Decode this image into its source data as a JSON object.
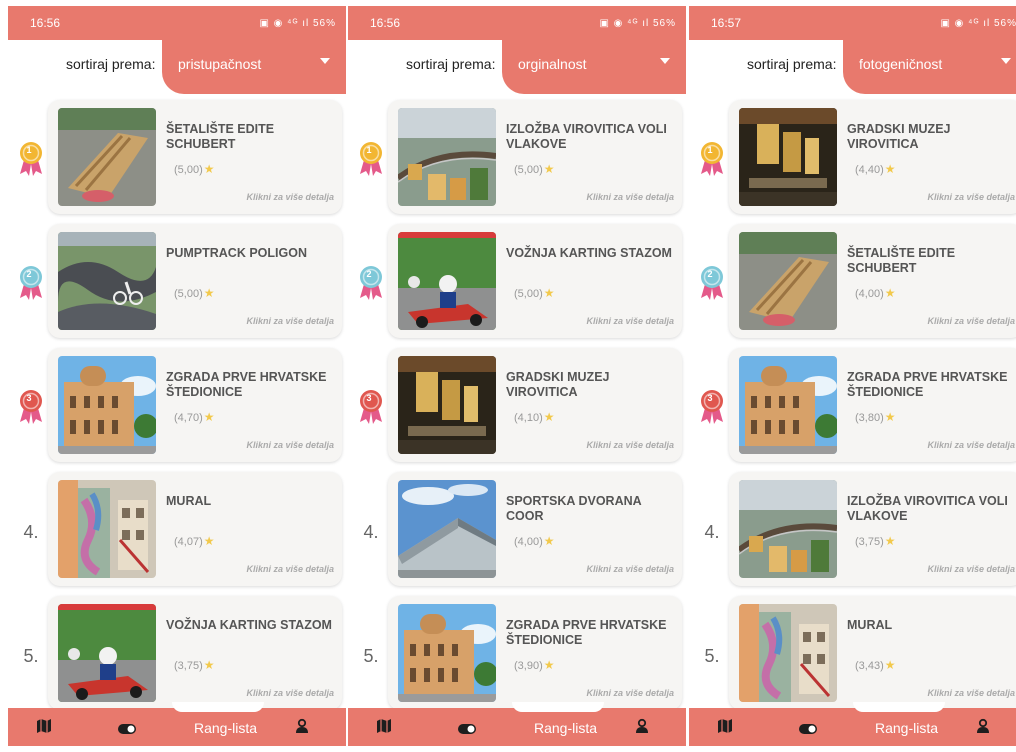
{
  "panels": [
    {
      "time": "16:56",
      "status_icons": "▣ ◉ ⁴ᴳ ıl 56%",
      "sort_label": "sortiraj prema:",
      "sort_value": "pristupačnost",
      "items": [
        {
          "rank": "1",
          "title": "ŠETALIŠTE EDITE SCHUBERT",
          "rating": "(5,00)",
          "detail": "Klikni za više detalja",
          "thumb": "promenade"
        },
        {
          "rank": "2",
          "title": "PUMPTRACK POLIGON",
          "rating": "(5,00)",
          "detail": "Klikni za više detalja",
          "thumb": "pumptrack"
        },
        {
          "rank": "3",
          "title": "ZGRADA PRVE HRVATSKE ŠTEDIONICE",
          "rating": "(4,70)",
          "detail": "Klikni za više detalja",
          "thumb": "building"
        },
        {
          "rank": "4.",
          "title": "MURAL",
          "rating": "(4,07)",
          "detail": "Klikni za više detalja",
          "thumb": "mural"
        },
        {
          "rank": "5.",
          "title": "VOŽNJA KARTING STAZOM",
          "rating": "(3,75)",
          "detail": "Klikni za više detalja",
          "thumb": "karting"
        }
      ]
    },
    {
      "time": "16:56",
      "status_icons": "▣ ◉ ⁴ᴳ ıl 56%",
      "sort_label": "sortiraj prema:",
      "sort_value": "orginalnost",
      "items": [
        {
          "rank": "1",
          "title": "IZLOŽBA VIROVITICA VOLI VLAKOVE",
          "rating": "(5,00)",
          "detail": "Klikni za više detalja",
          "thumb": "trains"
        },
        {
          "rank": "2",
          "title": "VOŽNJA KARTING STAZOM",
          "rating": "(5,00)",
          "detail": "Klikni za više detalja",
          "thumb": "karting"
        },
        {
          "rank": "3",
          "title": "GRADSKI MUZEJ VIROVITICA",
          "rating": "(4,10)",
          "detail": "Klikni za više detalja",
          "thumb": "museum"
        },
        {
          "rank": "4.",
          "title": "SPORTSKA DVORANA COOR",
          "rating": "(4,00)",
          "detail": "Klikni za više detalja",
          "thumb": "hall"
        },
        {
          "rank": "5.",
          "title": "ZGRADA PRVE HRVATSKE ŠTEDIONICE",
          "rating": "(3,90)",
          "detail": "Klikni za više detalja",
          "thumb": "building"
        }
      ]
    },
    {
      "time": "16:57",
      "status_icons": "▣ ◉ ⁴ᴳ ıl 56%",
      "sort_label": "sortiraj prema:",
      "sort_value": "fotogeničnost",
      "items": [
        {
          "rank": "1",
          "title": "GRADSKI MUZEJ VIROVITICA",
          "rating": "(4,40)",
          "detail": "Klikni za više detalja",
          "thumb": "museum"
        },
        {
          "rank": "2",
          "title": "ŠETALIŠTE EDITE SCHUBERT",
          "rating": "(4,00)",
          "detail": "Klikni za više detalja",
          "thumb": "promenade"
        },
        {
          "rank": "3",
          "title": "ZGRADA PRVE HRVATSKE ŠTEDIONICE",
          "rating": "(3,80)",
          "detail": "Klikni za više detalja",
          "thumb": "building"
        },
        {
          "rank": "4.",
          "title": "IZLOŽBA VIROVITICA VOLI VLAKOVE",
          "rating": "(3,75)",
          "detail": "Klikni za više detalja",
          "thumb": "trains"
        },
        {
          "rank": "5.",
          "title": "MURAL",
          "rating": "(3,43)",
          "detail": "Klikni za više detalja",
          "thumb": "mural"
        }
      ]
    }
  ],
  "nav": {
    "label": "Rang-lista",
    "icons": [
      "map-icon",
      "toggle-icon",
      "user-icon"
    ]
  },
  "icons": {
    "medal": "medal-icon",
    "star": "star-icon",
    "caret": "chevron-down-icon"
  },
  "colors": {
    "accent": "#e8796d",
    "gold": "#f2b632",
    "silver": "#7ec8d8",
    "bronze": "#e0574f",
    "ribbon": "#e45a8a",
    "card": "#f6f5f3"
  }
}
